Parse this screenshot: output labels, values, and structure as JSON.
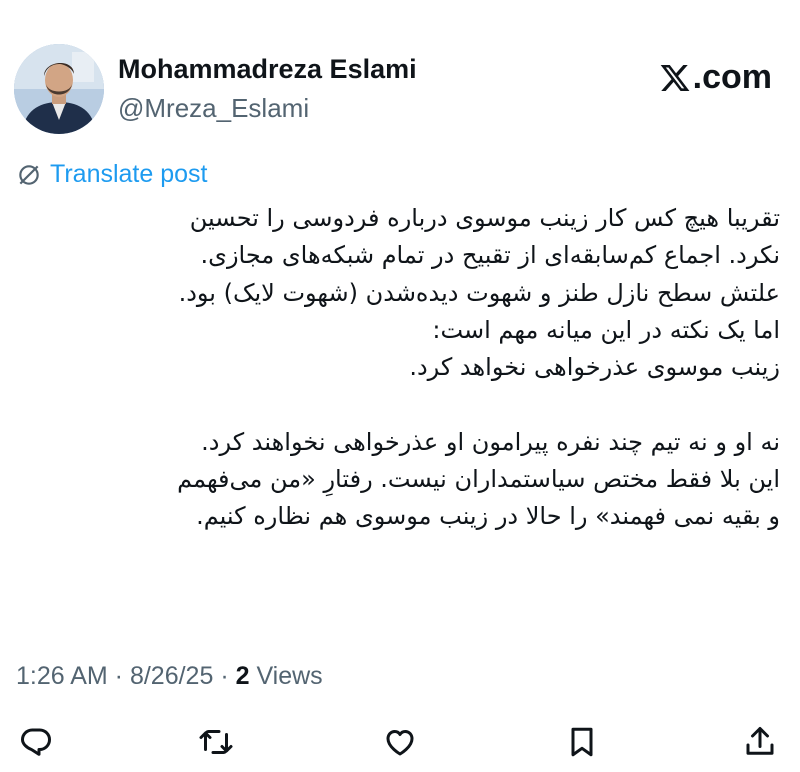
{
  "author": {
    "display_name": "Mohammadreza Eslami",
    "handle": "@Mreza_Eslami"
  },
  "brand": {
    "logo_icon": "x-logo-icon",
    "domain": ".com"
  },
  "translate": {
    "icon": "globe-slash-icon",
    "label": "Translate post"
  },
  "post": {
    "lines": [
      "تقریبا هیچ کس کار زینب موسوی درباره فردوسی را تحسین",
      "نکرد. اجماع کم‌سابقه‌ای از تقبیح در تمام شبکه‌های مجازی.",
      "علتش سطح نازل طنز و شهوت دیده‌شدن (شهوت لایک) بود.",
      "اما یک نکته در این میانه مهم است:",
      "زینب موسوی عذرخواهی نخواهد کرد.",
      "",
      "نه او و نه تیم چند نفره پیرامون او عذرخواهی نخواهند کرد.",
      "این بلا فقط مختص سیاستمداران نیست. رفتارِ «من می‌فهمم",
      "و بقیه نمی فهمند» را حالا در زینب موسوی هم نظاره کنیم."
    ]
  },
  "meta": {
    "time": "1:26 AM",
    "separator": " · ",
    "date": "8/26/25",
    "views_count": "2",
    "views_label": " Views"
  },
  "actions": {
    "reply": "reply-icon",
    "repost": "repost-icon",
    "like": "like-icon",
    "bookmark": "bookmark-icon",
    "share": "share-icon"
  },
  "colors": {
    "link": "#1d9bf0",
    "muted": "#536471",
    "text": "#0f1419"
  }
}
